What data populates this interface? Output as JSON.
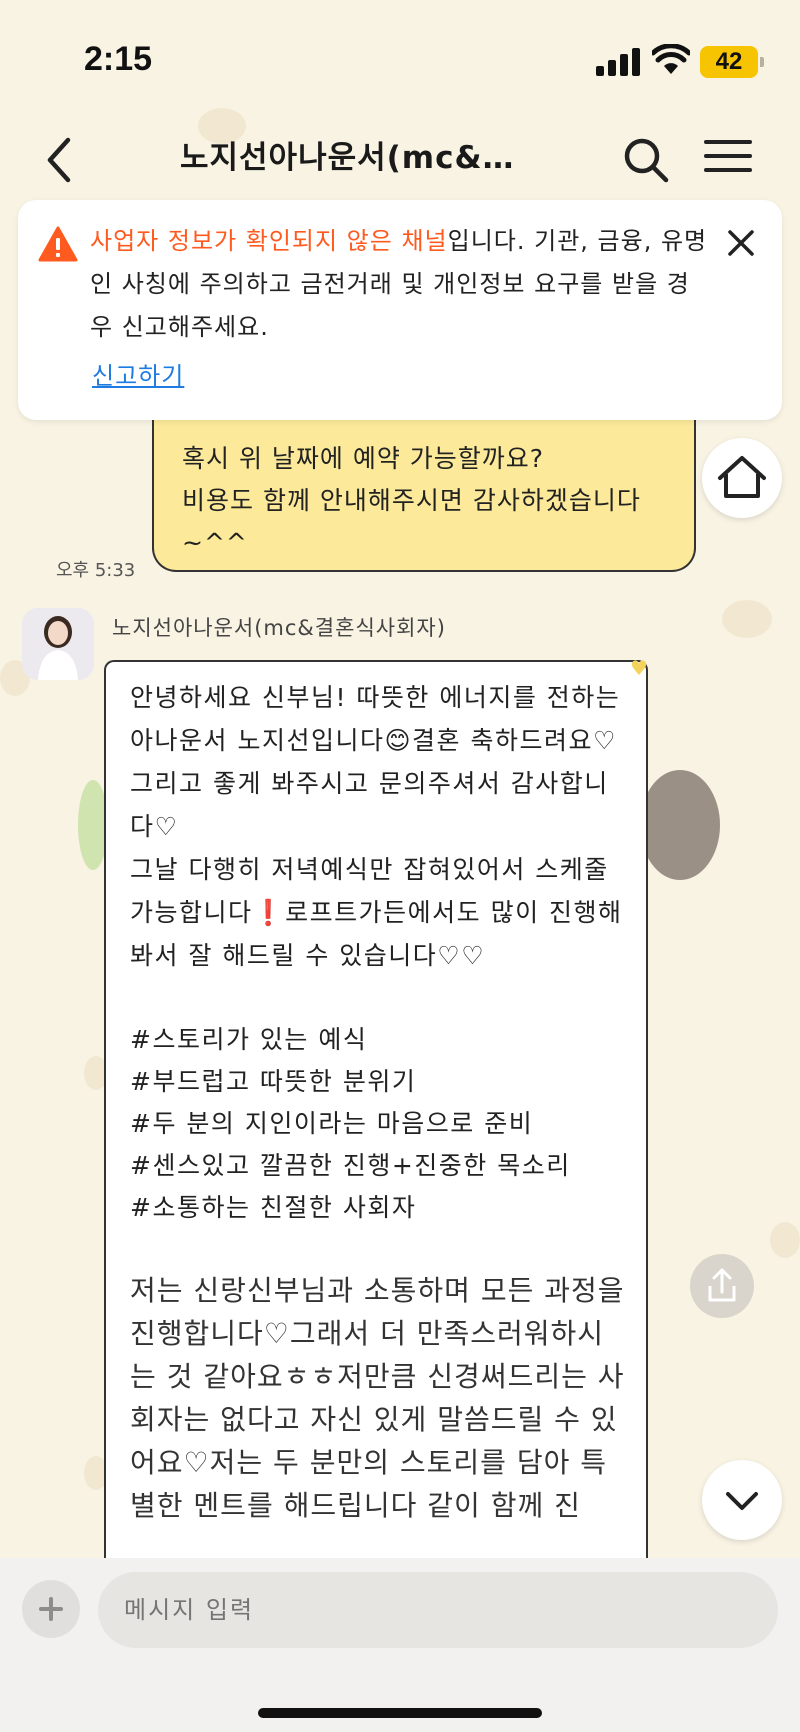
{
  "status_bar": {
    "time": "2:15",
    "battery": "42"
  },
  "header": {
    "title": "노지선아나운서(mc&…"
  },
  "banner": {
    "highlight": "사업자 정보가 확인되지 않은 채널",
    "text": "입니다. 기관, 금융, 유명인 사칭에 주의하고 금전거래 및 개인정보 요구를 받을 경우 신고해주세요.",
    "report_label": "신고하기"
  },
  "my_message": {
    "text": "혹시 위 날짜에 예약 가능할까요?\n비용도 함께 안내해주시면 감사하겠습니다~^^",
    "time": "오후 5:33"
  },
  "their_message": {
    "sender": "노지선아나운서(mc&결혼식사회자)",
    "para1": "안녕하세요 신부님! 따뜻한 에너지를 전하는 아나운서 노지선입니다😊결혼 축하드려요♡그리고 좋게 봐주시고 문의주셔서 감사합니다♡\n그날 다행히 저녁예식만 잡혀있어서 스케줄 가능합니다❗로프트가든에서도 많이 진행해봐서 잘 해드릴 수 있습니다♡♡",
    "tags": "#스토리가 있는 예식\n#부드럽고 따뜻한 분위기\n#두 분의 지인이라는 마음으로 준비\n#센스있고 깔끔한 진행+진중한 목소리\n#소통하는 친절한 사회자",
    "para2": "저는 신랑신부님과 소통하며 모든 과정을 진행합니다♡그래서 더 만족스러워하시는 것 같아요ㅎㅎ저만큼 신경써드리는 사회자는 없다고 자신 있게 말씀드릴 수 있어요♡저는 두 분만의 스토리를 담아 특별한 멘트를 해드립니다 같이 함께 진"
  },
  "composer": {
    "placeholder": "메시지 입력"
  },
  "icons": {
    "back": "chevron-left-icon",
    "search": "search-icon",
    "menu": "hamburger-icon",
    "warning": "warning-icon",
    "close": "close-icon",
    "home": "home-icon",
    "share": "share-icon",
    "down": "chevron-down-icon",
    "plus": "plus-icon"
  },
  "colors": {
    "background": "#f8f3e3",
    "my_bubble": "#fcea9a",
    "warning": "#ff5a1f",
    "link": "#1e7ce0",
    "battery": "#f6c400"
  }
}
